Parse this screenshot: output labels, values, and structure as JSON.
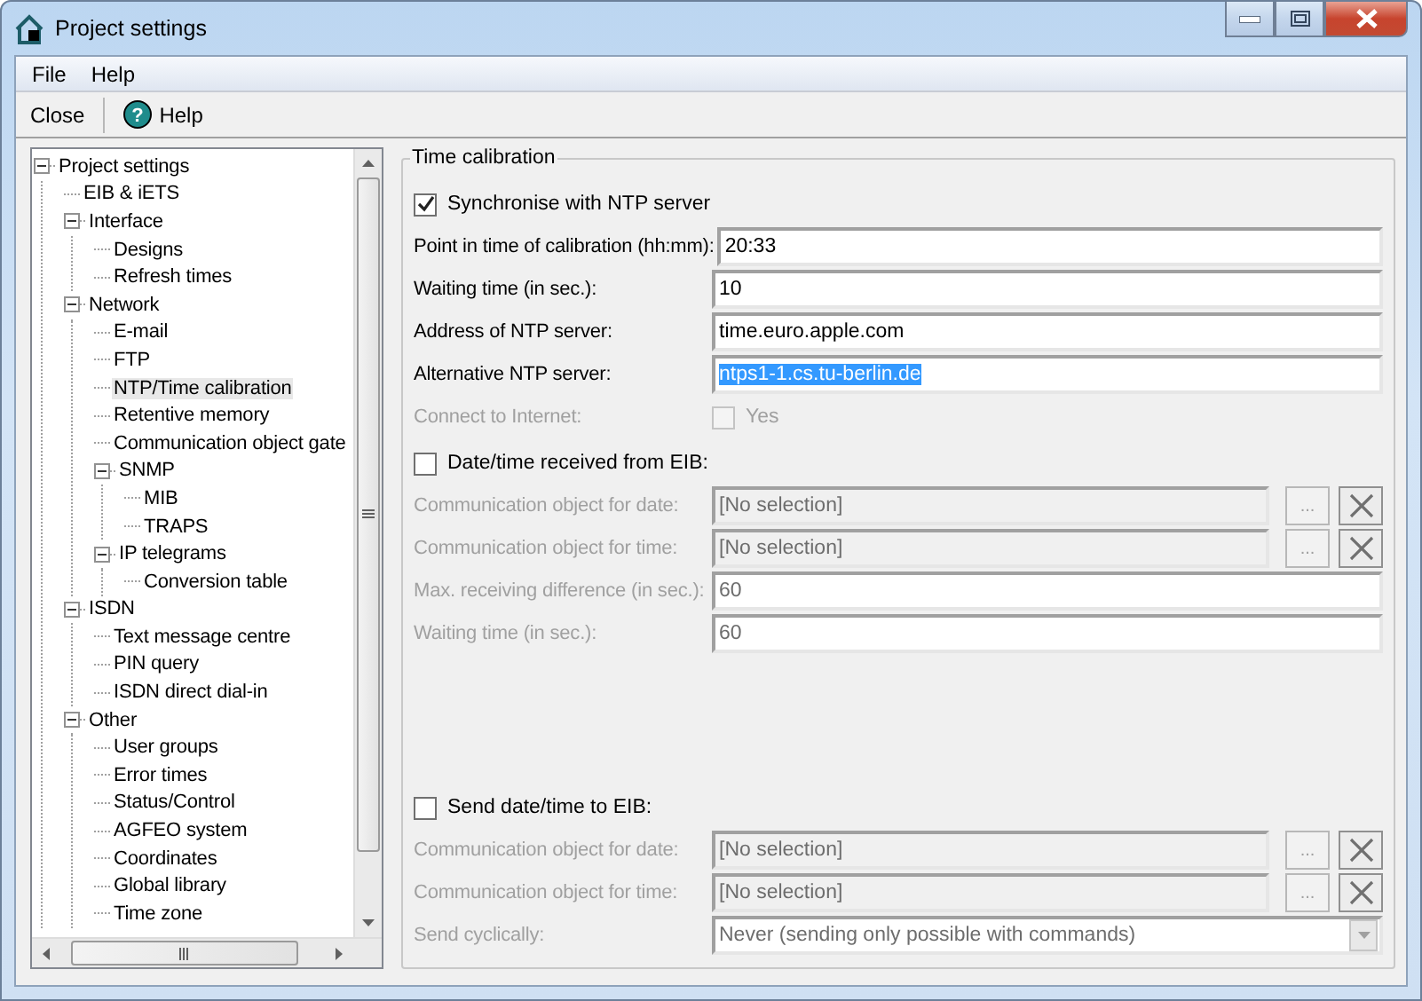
{
  "window": {
    "title": "Project settings"
  },
  "menu": [
    "File",
    "Help"
  ],
  "toolbar": [
    {
      "label": "Close",
      "kind": "text"
    },
    {
      "label": "Help",
      "kind": "help",
      "icon": "?"
    }
  ],
  "tree": [
    {
      "label": "Project settings",
      "expanded": true,
      "selected": false,
      "children": [
        {
          "label": "EIB & iETS",
          "selected": false
        },
        {
          "label": "Interface",
          "expanded": true,
          "selected": false,
          "children": [
            {
              "label": "Designs",
              "selected": false
            },
            {
              "label": "Refresh times",
              "selected": false
            }
          ]
        },
        {
          "label": "Network",
          "expanded": true,
          "selected": false,
          "children": [
            {
              "label": "E-mail",
              "selected": false
            },
            {
              "label": "FTP",
              "selected": false
            },
            {
              "label": "NTP/Time calibration",
              "selected": true
            },
            {
              "label": "Retentive memory",
              "selected": false
            },
            {
              "label": "Communication object gate",
              "selected": false
            },
            {
              "label": "SNMP",
              "expanded": true,
              "selected": false,
              "children": [
                {
                  "label": "MIB",
                  "selected": false
                },
                {
                  "label": "TRAPS",
                  "selected": false
                }
              ]
            },
            {
              "label": "IP telegrams",
              "expanded": true,
              "selected": false,
              "children": [
                {
                  "label": "Conversion table",
                  "selected": false
                }
              ]
            }
          ]
        },
        {
          "label": "ISDN",
          "expanded": true,
          "selected": false,
          "children": [
            {
              "label": "Text message centre",
              "selected": false
            },
            {
              "label": "PIN query",
              "selected": false
            },
            {
              "label": "ISDN direct dial-in",
              "selected": false
            }
          ]
        },
        {
          "label": "Other",
          "expanded": true,
          "selected": false,
          "children": [
            {
              "label": "User groups",
              "selected": false
            },
            {
              "label": "Error times",
              "selected": false
            },
            {
              "label": "Status/Control",
              "selected": false
            },
            {
              "label": "AGFEO system",
              "selected": false
            },
            {
              "label": "Coordinates",
              "selected": false
            },
            {
              "label": "Global library",
              "selected": false
            },
            {
              "label": "Time zone",
              "selected": false
            }
          ]
        }
      ]
    }
  ],
  "group": {
    "title": "Time calibration",
    "sections": [
      {
        "header": {
          "label": "Synchronise with NTP server",
          "checked": true
        },
        "rows": [
          {
            "kind": "field",
            "label": "Point in time of calibration (hh:mm):",
            "value": "20:33",
            "disabled": false
          },
          {
            "kind": "field",
            "label": "Waiting time (in sec.):",
            "value": "10",
            "disabled": false
          },
          {
            "kind": "field",
            "label": "Address of NTP server:",
            "value": "time.euro.apple.com",
            "disabled": false
          },
          {
            "kind": "field",
            "label": "Alternative NTP server:",
            "value": "ntps1-1.cs.tu-berlin.de",
            "disabled": false,
            "highlighted": true
          },
          {
            "kind": "check",
            "label": "Connect to Internet:",
            "value": "Yes",
            "checked": false,
            "disabled": true
          }
        ]
      },
      {
        "header": {
          "label": "Date/time received from EIB:",
          "checked": false
        },
        "rows": [
          {
            "kind": "object",
            "label": "Communication object for date:",
            "value": "[No selection]",
            "button": "...",
            "disabled": true
          },
          {
            "kind": "object",
            "label": "Communication object for time:",
            "value": "[No selection]",
            "button": "...",
            "disabled": true
          },
          {
            "kind": "field",
            "label": "Max. receiving difference (in sec.):",
            "value": "60",
            "disabled": true
          },
          {
            "kind": "field",
            "label": "Waiting time (in sec.):",
            "value": "60",
            "disabled": true
          }
        ]
      },
      {
        "header": {
          "label": "Send date/time to EIB:",
          "checked": false
        },
        "rows": [
          {
            "kind": "object",
            "label": "Communication object for date:",
            "value": "[No selection]",
            "button": "...",
            "disabled": true
          },
          {
            "kind": "object",
            "label": "Communication object for time:",
            "value": "[No selection]",
            "button": "...",
            "disabled": true
          },
          {
            "kind": "select",
            "label": "Send cyclically:",
            "value": "Never (sending only possible with commands)",
            "disabled": true
          }
        ]
      }
    ]
  }
}
